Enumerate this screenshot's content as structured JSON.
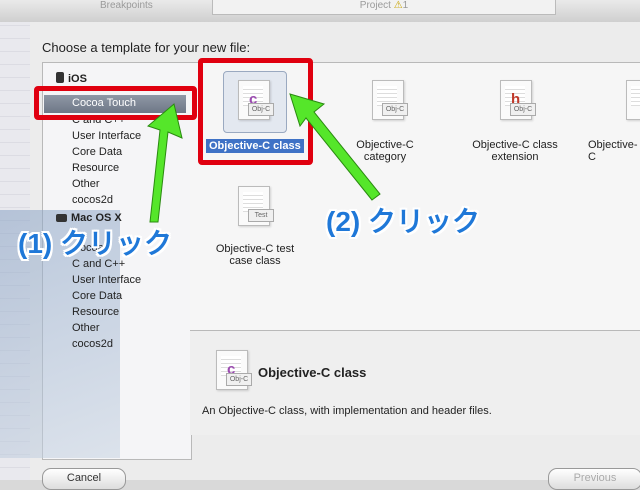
{
  "background": {
    "tab_left": "Breakpoints",
    "tab_right": "Project",
    "warning_count": "1"
  },
  "dialog": {
    "heading": "Choose a template for your new file:",
    "cancel": "Cancel",
    "previous": "Previous"
  },
  "sidebar": {
    "ios_group": "iOS",
    "ios_items": [
      "Cocoa Touch",
      "C and C++",
      "User Interface",
      "Core Data",
      "Resource",
      "Other",
      "cocos2d"
    ],
    "mac_group": "Mac OS X",
    "mac_items": [
      "Cocoa",
      "C and C++",
      "User Interface",
      "Core Data",
      "Resource",
      "Other",
      "cocos2d"
    ]
  },
  "templates": [
    {
      "label": "Objective-C class",
      "badge": "Obj-C",
      "icon": "objc-class-icon"
    },
    {
      "label": "Objective-C category",
      "badge": "Obj-C",
      "icon": "objc-category-icon"
    },
    {
      "label": "Objective-C class extension",
      "badge": "Obj-C",
      "icon": "objc-extension-icon"
    },
    {
      "label": "Objective-C",
      "icon": "objc-protocol-icon"
    },
    {
      "label": "Objective-C test case class",
      "badge": "Test",
      "icon": "objc-test-icon"
    }
  ],
  "detail": {
    "title": "Objective-C class",
    "badge": "Obj-C",
    "description": "An Objective-C class, with implementation and header files."
  },
  "annotations": {
    "step1": "(1) クリック",
    "step2": "(2) クリック"
  },
  "colors": {
    "annotation_red": "#e0000f",
    "annotation_green": "#55e62a",
    "annotation_blue": "#1f78d8",
    "selection_blue": "#3f72c6"
  }
}
